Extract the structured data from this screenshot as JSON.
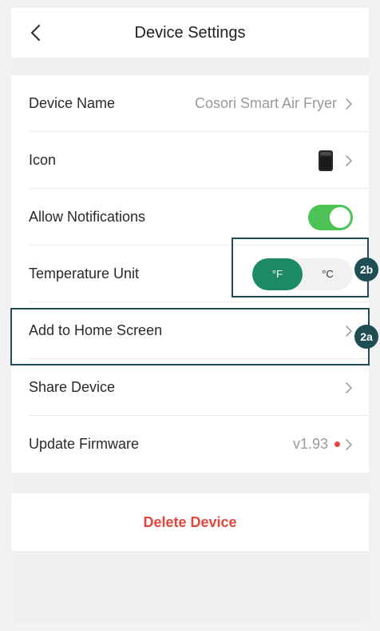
{
  "header": {
    "title": "Device Settings"
  },
  "settings": {
    "device_name": {
      "label": "Device Name",
      "value": "Cosori Smart Air Fryer"
    },
    "icon": {
      "label": "Icon"
    },
    "allow_notifications": {
      "label": "Allow Notifications",
      "enabled": true
    },
    "temperature_unit": {
      "label": "Temperature Unit",
      "options": [
        "°F",
        "°C"
      ],
      "selected": "°F"
    },
    "add_home": {
      "label": "Add to Home Screen"
    },
    "share": {
      "label": "Share Device"
    },
    "firmware": {
      "label": "Update Firmware",
      "value": "v1.93"
    }
  },
  "delete": {
    "label": "Delete Device"
  },
  "annotations": {
    "badge_a": "2a",
    "badge_b": "2b"
  },
  "colors": {
    "accent_green": "#1c8b64",
    "toggle_green": "#4cc257",
    "danger_red": "#e5473d",
    "annotation_teal": "#1e4d54"
  }
}
